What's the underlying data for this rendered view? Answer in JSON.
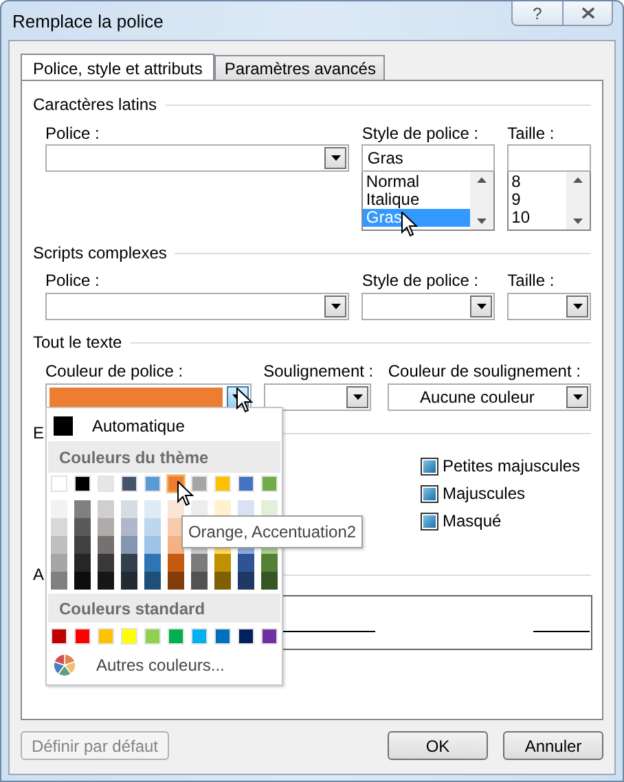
{
  "window": {
    "title": "Remplace la police",
    "help_button": "?"
  },
  "tabs": [
    {
      "label": "Police, style et attributs",
      "selected": true
    },
    {
      "label": "Paramètres avancés",
      "selected": false
    }
  ],
  "latin": {
    "heading": "Caractères latins",
    "font_label": "Police :",
    "style_label": "Style de police :",
    "size_label": "Taille :",
    "style_value": "Gras",
    "style_options": [
      {
        "label": "Normal",
        "selected": false
      },
      {
        "label": "Italique",
        "selected": false
      },
      {
        "label": "Gras",
        "selected": true
      }
    ],
    "size_options": [
      {
        "label": "8",
        "selected": false
      },
      {
        "label": "9",
        "selected": false
      },
      {
        "label": "10",
        "selected": false
      }
    ]
  },
  "complex": {
    "heading": "Scripts complexes",
    "font_label": "Police :",
    "style_label": "Style de police :",
    "size_label": "Taille :"
  },
  "all_text": {
    "heading": "Tout le texte",
    "font_color_label": "Couleur de police :",
    "font_color": {
      "color": "#ed7d31"
    },
    "font_color_open": true,
    "underline_label": "Soulignement :",
    "underline_color_label": "Couleur de soulignement :",
    "underline_color_value": "Aucune couleur"
  },
  "effects": {
    "heading": "E",
    "options": [
      {
        "label": "Petites majuscules",
        "indeterminate": true
      },
      {
        "label": "Majuscules",
        "indeterminate": true
      },
      {
        "label": "Masqué",
        "indeterminate": true
      }
    ]
  },
  "preview": {
    "heading": "A"
  },
  "color_menu": {
    "automatic": "Automatique",
    "theme_heading": "Couleurs du thème",
    "standard_heading": "Couleurs standard",
    "more_colors": "Autres couleurs...",
    "tooltip": "Orange, Accentuation2",
    "theme_colors": [
      {
        "color": "#ffffff",
        "selected": false
      },
      {
        "color": "#000000",
        "selected": false
      },
      {
        "color": "#e7e6e6",
        "selected": false
      },
      {
        "color": "#44546a",
        "selected": false
      },
      {
        "color": "#5b9bd5",
        "selected": false
      },
      {
        "color": "#ed7d31",
        "selected": true
      },
      {
        "color": "#a5a5a5",
        "selected": false
      },
      {
        "color": "#ffc000",
        "selected": false
      },
      {
        "color": "#4472c4",
        "selected": false
      },
      {
        "color": "#70ad47",
        "selected": false
      }
    ],
    "shade_rows": [
      [
        {
          "color": "#f2f2f2"
        },
        {
          "color": "#808080"
        },
        {
          "color": "#d0cece"
        },
        {
          "color": "#d6dce4"
        },
        {
          "color": "#deebf6"
        },
        {
          "color": "#fbe5d5"
        },
        {
          "color": "#ededed"
        },
        {
          "color": "#fff2cc"
        },
        {
          "color": "#d9e2f3"
        },
        {
          "color": "#e2efd9"
        }
      ],
      [
        {
          "color": "#d9d9d9"
        },
        {
          "color": "#595959"
        },
        {
          "color": "#aeabab"
        },
        {
          "color": "#adb9ca"
        },
        {
          "color": "#bdd7ee"
        },
        {
          "color": "#f7cbac"
        }
      ],
      [
        {
          "color": "#bfbfbf"
        },
        {
          "color": "#404040"
        },
        {
          "color": "#757171"
        },
        {
          "color": "#8497b0"
        },
        {
          "color": "#9dc3e6"
        },
        {
          "color": "#f4b183"
        },
        {
          "color": "#c9c9c9"
        },
        {
          "color": "#ffd965"
        },
        {
          "color": "#8eaadb"
        },
        {
          "color": "#a8d08d"
        }
      ],
      [
        {
          "color": "#a6a6a6"
        },
        {
          "color": "#262626"
        },
        {
          "color": "#3a3838"
        },
        {
          "color": "#333f4f"
        },
        {
          "color": "#2e75b5"
        },
        {
          "color": "#c55a11"
        },
        {
          "color": "#7b7b7b"
        },
        {
          "color": "#bf9000"
        },
        {
          "color": "#2f5496"
        },
        {
          "color": "#538135"
        }
      ],
      [
        {
          "color": "#808080"
        },
        {
          "color": "#0d0d0d"
        },
        {
          "color": "#171616"
        },
        {
          "color": "#222a35"
        },
        {
          "color": "#1f4e79"
        },
        {
          "color": "#843c0b"
        },
        {
          "color": "#525252"
        },
        {
          "color": "#7f6000"
        },
        {
          "color": "#1f3864"
        },
        {
          "color": "#375623"
        }
      ]
    ],
    "standard_colors": [
      {
        "color": "#c00000"
      },
      {
        "color": "#ff0000"
      },
      {
        "color": "#ffc000"
      },
      {
        "color": "#ffff00"
      },
      {
        "color": "#92d050"
      },
      {
        "color": "#00b050"
      },
      {
        "color": "#00b0f0"
      },
      {
        "color": "#0070c0"
      },
      {
        "color": "#002060"
      },
      {
        "color": "#7030a0"
      }
    ]
  },
  "buttons": [
    {
      "label": "Définir par défaut",
      "disabled": true
    },
    {
      "label": "OK",
      "disabled": false
    },
    {
      "label": "Annuler",
      "disabled": false
    }
  ]
}
